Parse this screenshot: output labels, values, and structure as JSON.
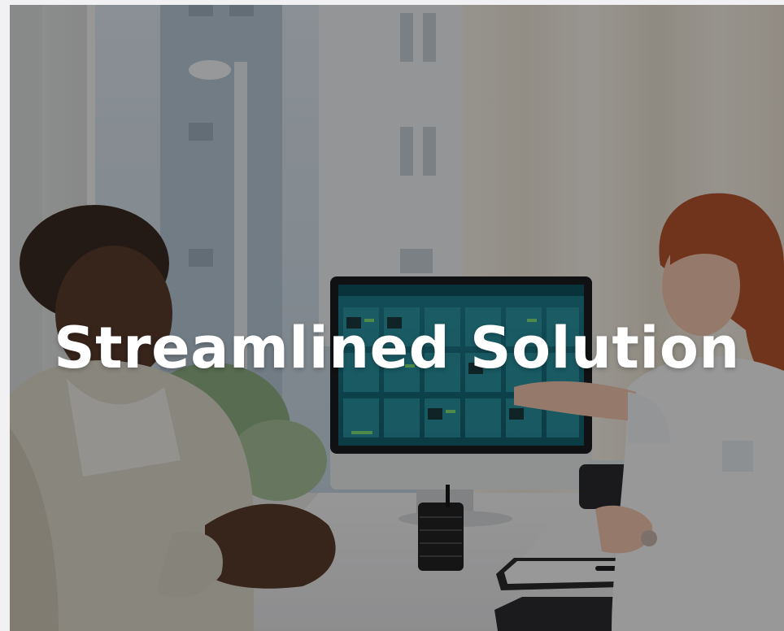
{
  "hero": {
    "title": "Streamlined Solution",
    "image_subject": "doctor-showing-patient-monitoring-dashboard-photo"
  },
  "colors": {
    "overlay": "#000000",
    "title_text": "#ffffff",
    "page_background": "#f1f1f4"
  }
}
